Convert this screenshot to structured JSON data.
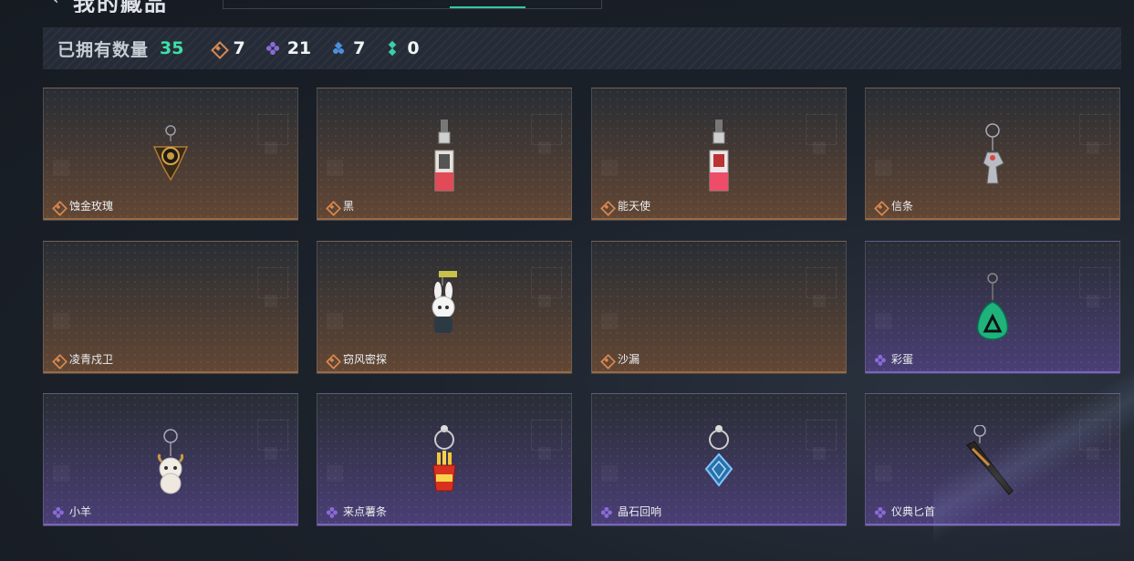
{
  "header": {
    "back_icon": "arrow-left-icon",
    "title": "我的藏品"
  },
  "colors": {
    "accent": "#3fe0a8",
    "tier_orange": "#d9884f",
    "tier_purple": "#8a6ad8",
    "tier_blue": "#4d8fe0",
    "tier_green": "#3ccfa6"
  },
  "stats": {
    "label": "已拥有数量",
    "total": "35",
    "items": [
      {
        "icon": "orange-diamond-gem-icon",
        "count": "7"
      },
      {
        "icon": "purple-clover-gem-icon",
        "count": "21"
      },
      {
        "icon": "blue-tri-gem-icon",
        "count": "7"
      },
      {
        "icon": "green-dots-gem-icon",
        "count": "0"
      }
    ]
  },
  "charms": [
    {
      "name": "蚀金玫瑰",
      "tier": "orange",
      "icon": "rose-charm-icon"
    },
    {
      "name": "黑",
      "tier": "orange",
      "icon": "card-charm-icon"
    },
    {
      "name": "能天使",
      "tier": "orange",
      "icon": "card-charm-icon"
    },
    {
      "name": "信条",
      "tier": "orange",
      "icon": "figure-charm-icon"
    },
    {
      "name": "凌青戍卫",
      "tier": "orange",
      "icon": ""
    },
    {
      "name": "窃风密探",
      "tier": "orange",
      "icon": "rabbit-charm-icon"
    },
    {
      "name": "沙漏",
      "tier": "orange",
      "icon": ""
    },
    {
      "name": "彩蛋",
      "tier": "purple",
      "icon": "egg-charm-icon"
    },
    {
      "name": "小羊",
      "tier": "purple",
      "icon": "sheep-charm-icon"
    },
    {
      "name": "来点薯条",
      "tier": "purple",
      "icon": "fries-charm-icon"
    },
    {
      "name": "晶石回响",
      "tier": "purple",
      "icon": "crystal-charm-icon"
    },
    {
      "name": "仪典匕首",
      "tier": "purple",
      "icon": "dagger-charm-icon"
    }
  ]
}
